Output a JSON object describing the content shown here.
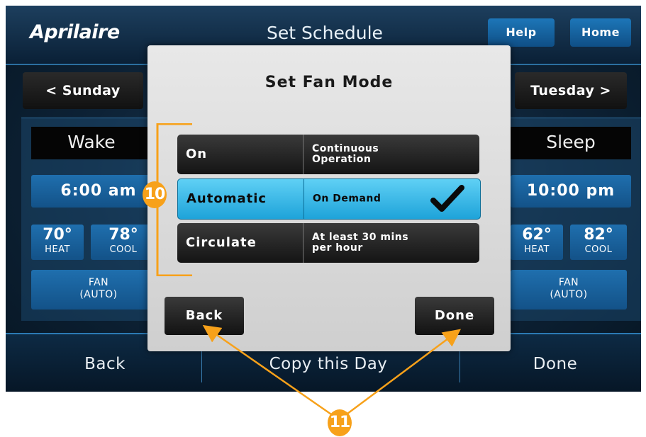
{
  "app": {
    "logo": "Aprilaire",
    "screen_title": "Set Schedule",
    "help_label": "Help",
    "home_label": "Home",
    "accent": "#1b6eb0",
    "highlight": "#f7a11a"
  },
  "nav": {
    "prev_day": "< Sunday",
    "next_day": "Tuesday >"
  },
  "left_panel": {
    "period": "Wake",
    "time": "6:00 am",
    "heat_temp": "70°",
    "heat_label": "HEAT",
    "cool_temp": "78°",
    "cool_label": "COOL",
    "fan_label": "FAN",
    "fan_mode": "(AUTO)"
  },
  "right_panel": {
    "period": "Sleep",
    "time": "10:00 pm",
    "heat_temp": "62°",
    "heat_label": "HEAT",
    "cool_temp": "82°",
    "cool_label": "COOL",
    "fan_label": "FAN",
    "fan_mode": "(AUTO)"
  },
  "bottom": {
    "back": "Back",
    "copy": "Copy this Day",
    "done": "Done"
  },
  "modal": {
    "title": "Set Fan Mode",
    "options": [
      {
        "name": "On",
        "desc_line1": "Continuous",
        "desc_line2": "Operation",
        "selected": false
      },
      {
        "name": "Automatic",
        "desc_line1": "On Demand",
        "desc_line2": "",
        "selected": true
      },
      {
        "name": "Circulate",
        "desc_line1": "At least 30 mins",
        "desc_line2": "per hour",
        "selected": false
      }
    ],
    "back_label": "Back",
    "done_label": "Done"
  },
  "callouts": {
    "options_marker": "10",
    "buttons_marker": "11"
  }
}
